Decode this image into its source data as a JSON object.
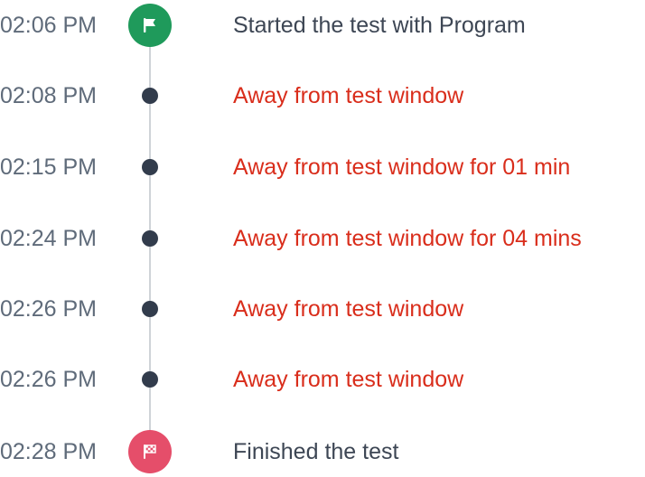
{
  "colors": {
    "time_text": "#5f6b7a",
    "normal_text": "#3d4654",
    "alert_text": "#d92d1b",
    "start_marker": "#1f9a5b",
    "end_marker": "#e54e6a",
    "dot_marker": "#323c4c",
    "spine": "#cfd3d8"
  },
  "events": [
    {
      "time": "02:06 PM",
      "text": "Started the test with Program",
      "kind": "normal",
      "marker": "start-flag-icon"
    },
    {
      "time": "02:08 PM",
      "text": "Away from test window",
      "kind": "alert",
      "marker": "dot"
    },
    {
      "time": "02:15 PM",
      "text": "Away from test window for 01 min",
      "kind": "alert",
      "marker": "dot"
    },
    {
      "time": "02:24 PM",
      "text": "Away from test window for 04 mins",
      "kind": "alert",
      "marker": "dot"
    },
    {
      "time": "02:26 PM",
      "text": "Away from test window",
      "kind": "alert",
      "marker": "dot"
    },
    {
      "time": "02:26 PM",
      "text": "Away from test window",
      "kind": "alert",
      "marker": "dot"
    },
    {
      "time": "02:28 PM",
      "text": "Finished the test",
      "kind": "normal",
      "marker": "checkered-flag-icon"
    }
  ]
}
